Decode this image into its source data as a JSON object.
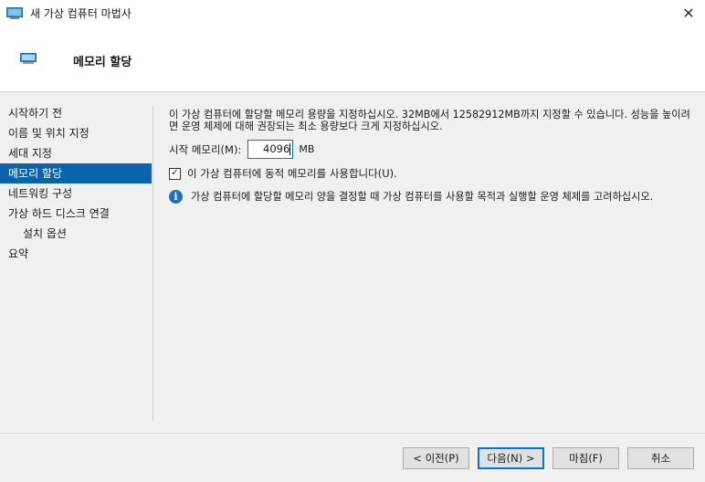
{
  "window": {
    "title": "새 가상 컴퓨터 마법사",
    "close_glyph": "✕"
  },
  "header": {
    "title": "메모리 할당"
  },
  "sidebar": {
    "items": [
      {
        "label": "시작하기 전"
      },
      {
        "label": "이름 및 위치 지정"
      },
      {
        "label": "세대 지정"
      },
      {
        "label": "메모리 할당"
      },
      {
        "label": "네트워킹 구성"
      },
      {
        "label": "가상 하드 디스크 연결"
      },
      {
        "label": "설치 옵션"
      },
      {
        "label": "요약"
      }
    ],
    "active_index": 3
  },
  "main": {
    "description": "이 가상 컴퓨터에 할당할 메모리 용량을 지정하십시오. 32MB에서 12582912MB까지 지정할 수 있습니다. 성능을 높이려면 운영 체제에 대해 권장되는 최소 용량보다 크게 지정하십시오.",
    "startup_memory_label": "시작 메모리(M):",
    "startup_memory_value": "4096",
    "startup_memory_unit": "MB",
    "dynamic_memory_label": "이 가상 컴퓨터에 동적 메모리를 사용합니다(U).",
    "dynamic_memory_checked": true,
    "check_glyph": "✓",
    "info_glyph": "i",
    "info_text": "가상 컴퓨터에 할당할 메모리 양을 결정할 때 가상 컴퓨터를 사용할 목적과 실행할 운영 체제를 고려하십시오."
  },
  "buttons": {
    "previous": "< 이전(P)",
    "next": "다음(N) >",
    "finish": "마침(F)",
    "cancel": "취소"
  },
  "colors": {
    "accent": "#0a64ad",
    "info": "#1a6fc0",
    "focus_border": "#0078d7"
  },
  "icons": {
    "app": "vm-monitor-icon",
    "header": "vm-monitor-icon",
    "info": "info-icon",
    "close": "close-icon",
    "check": "checkmark-icon"
  }
}
